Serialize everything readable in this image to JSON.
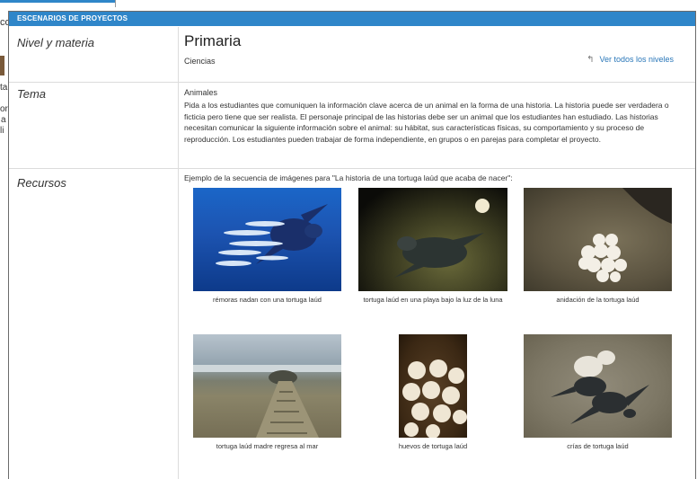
{
  "background": {
    "fragments": [
      "co",
      "ta",
      "or",
      "a",
      "li"
    ]
  },
  "modal": {
    "header": "ESCENARIOS DE PROYECTOS",
    "level_row": {
      "label": "Nivel y materia",
      "level": "Primaria",
      "subject": "Ciencias",
      "link_label": "Ver todos los niveles"
    },
    "topic_row": {
      "label": "Tema",
      "topic": "Animales",
      "description": "Pida a los estudiantes que comuniquen la información clave acerca de un animal en la forma de una historia. La historia puede ser verdadera o ficticia pero tiene que ser realista. El personaje principal de las historias debe ser un animal que los estudiantes han estudiado. Las historias necesitan comunicar la siguiente información sobre el animal: su hábitat, sus características físicas, su comportamiento y su proceso de reproducción. Los estudiantes pueden trabajar de forma independiente, en grupos o en parejas para completar el proyecto."
    },
    "resources_row": {
      "label": "Recursos",
      "intro": "Ejemplo de la secuencia de imágenes para \"La historia de una tortuga laúd que acaba de nacer\":",
      "images": [
        {
          "caption": "rémoras nadan con una tortuga laúd"
        },
        {
          "caption": "tortuga laúd en una playa bajo la luz de la luna"
        },
        {
          "caption": "anidación de la tortuga laúd"
        },
        {
          "caption": "tortuga laúd madre regresa al mar"
        },
        {
          "caption": "huevos de tortuga laúd"
        },
        {
          "caption": "crías de tortuga laúd"
        }
      ]
    }
  },
  "colors": {
    "accent": "#2f86c9",
    "link": "#2a77b9"
  }
}
